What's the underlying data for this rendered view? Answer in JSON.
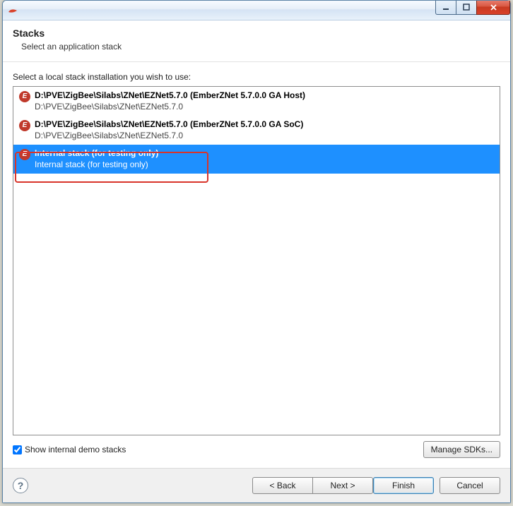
{
  "window": {
    "icons": {
      "app": "app-logo",
      "min": "minimize",
      "max": "maximize",
      "close": "close"
    }
  },
  "header": {
    "title": "Stacks",
    "subtitle": "Select an application stack"
  },
  "body": {
    "prompt": "Select a local stack installation you wish to use:",
    "stacks": [
      {
        "title": "D:\\PVE\\ZigBee\\Silabs\\ZNet\\EZNet5.7.0 (EmberZNet 5.7.0.0 GA Host)",
        "path": "D:\\PVE\\ZigBee\\Silabs\\ZNet\\EZNet5.7.0",
        "selected": false
      },
      {
        "title": "D:\\PVE\\ZigBee\\Silabs\\ZNet\\EZNet5.7.0 (EmberZNet 5.7.0.0 GA SoC)",
        "path": "D:\\PVE\\ZigBee\\Silabs\\ZNet\\EZNet5.7.0",
        "selected": false
      },
      {
        "title": "Internal stack (for testing only)",
        "path": "Internal stack (for testing only)",
        "selected": true
      }
    ],
    "show_internal_label": "Show internal demo stacks",
    "show_internal_checked": true,
    "manage_label": "Manage SDKs..."
  },
  "footer": {
    "help": "?",
    "back": "< Back",
    "next": "Next >",
    "finish": "Finish",
    "cancel": "Cancel"
  },
  "colors": {
    "selection": "#1e90ff",
    "annotation": "#d9342a"
  }
}
